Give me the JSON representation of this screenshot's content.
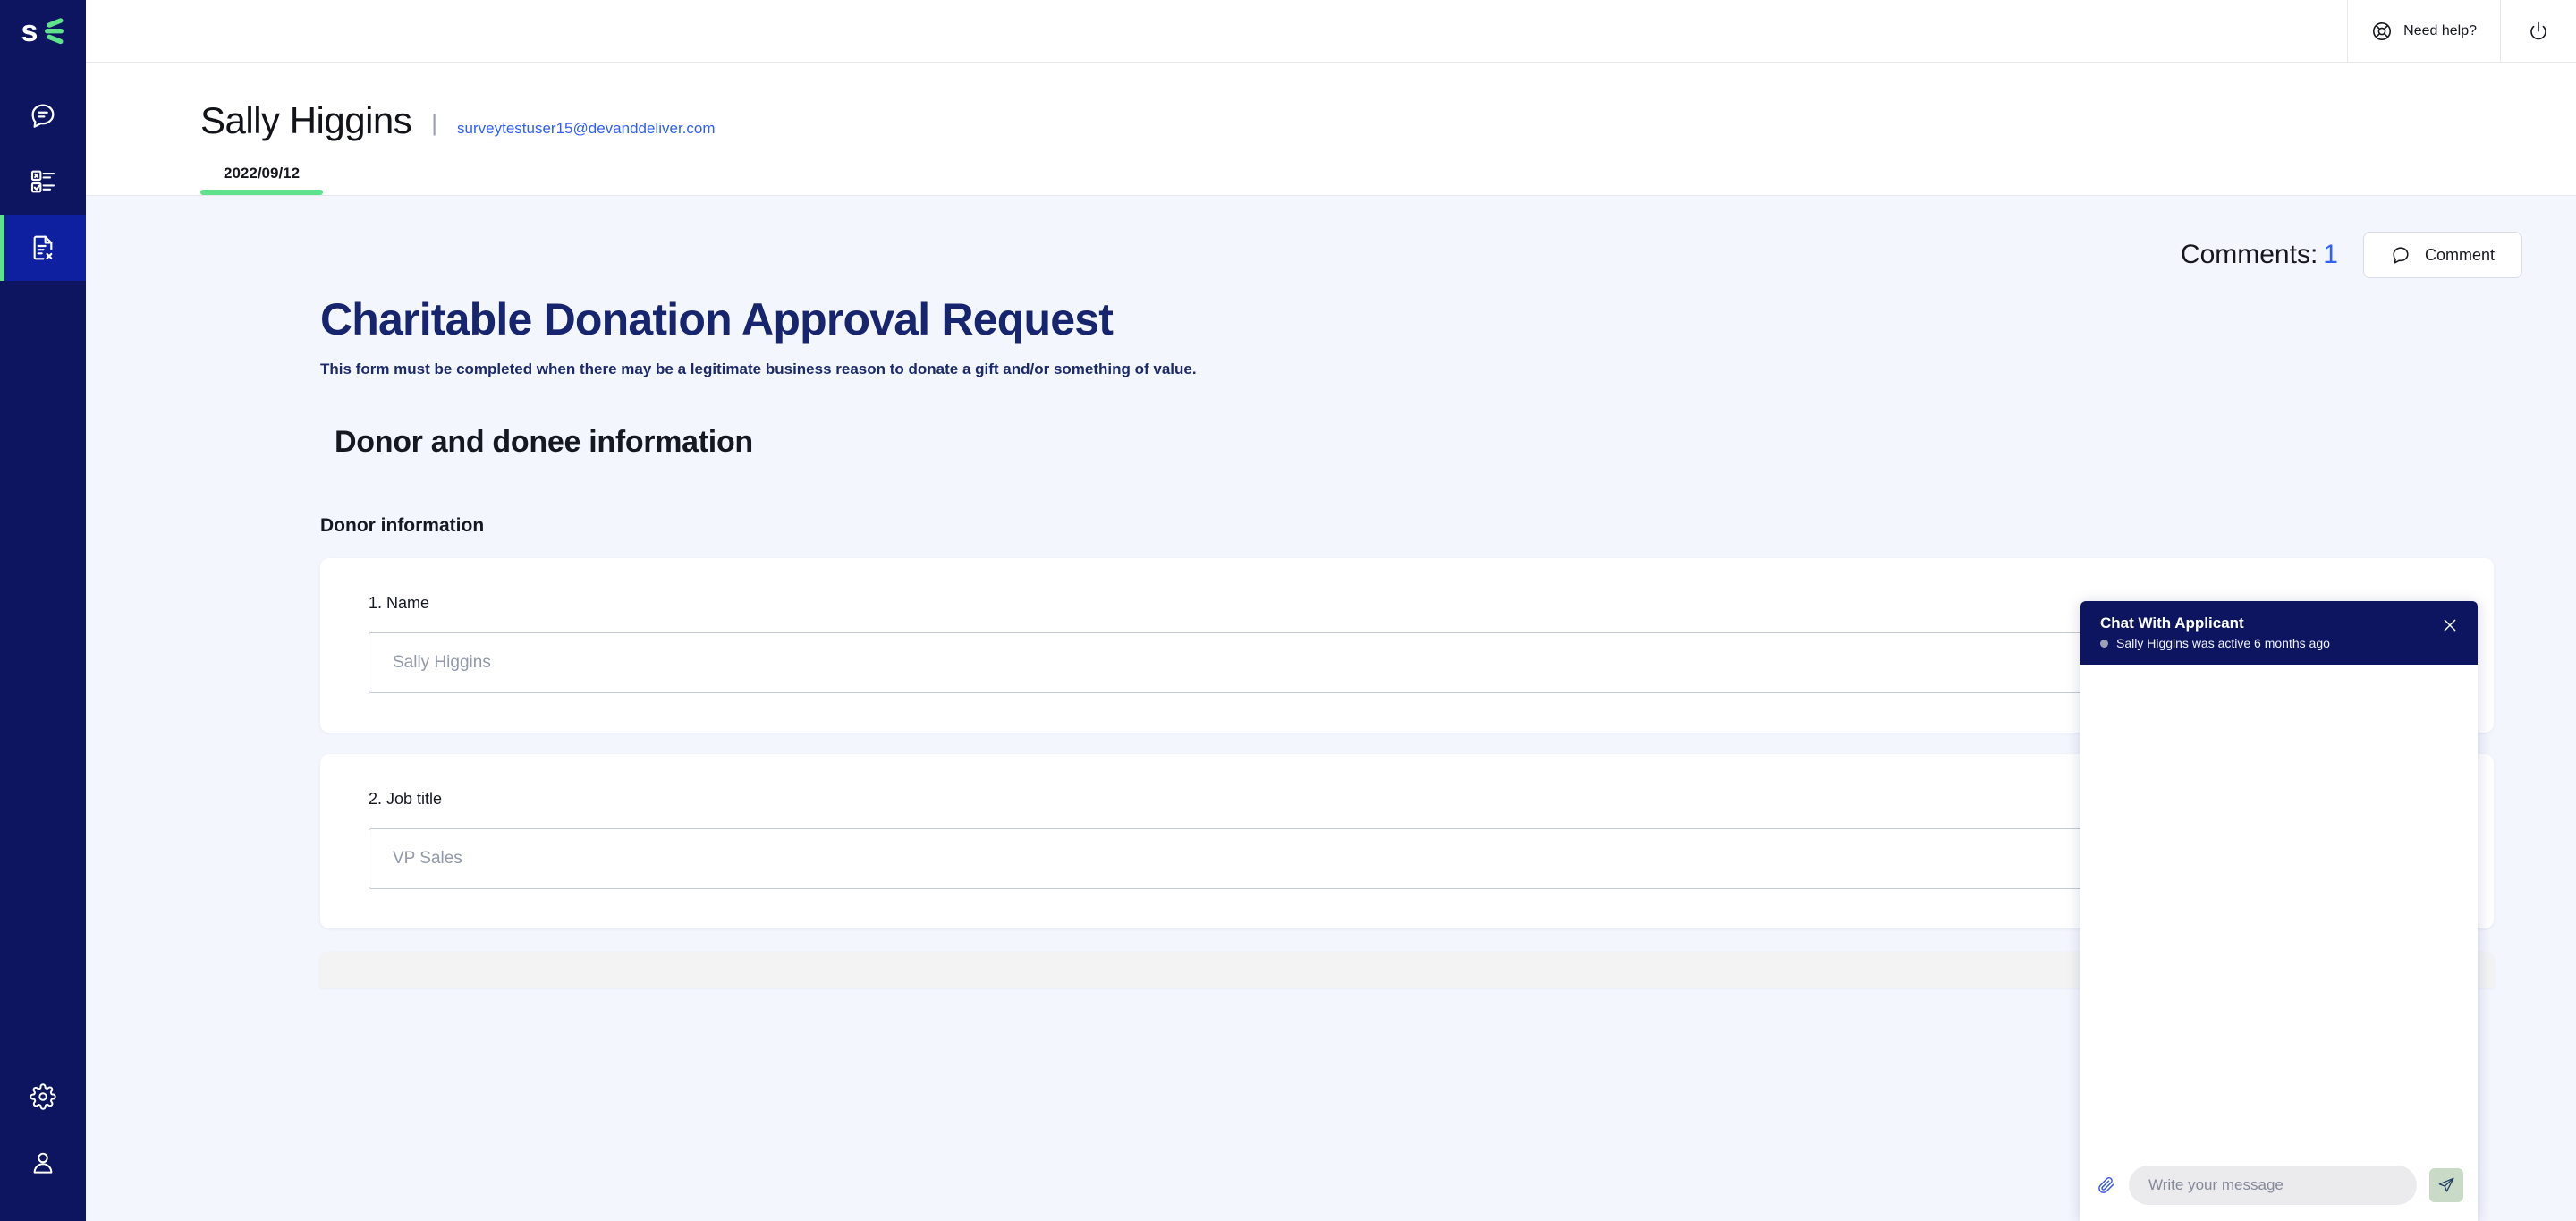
{
  "brand": {
    "logo_letter": "s",
    "navy": "#0d1560",
    "active_blue": "#0e20a0",
    "green": "#5ee28a",
    "link_blue": "#3160f6",
    "page_bg": "#f4f6fd"
  },
  "sidebar": {
    "items": [
      {
        "name": "chat-bubble-icon",
        "label": "Messages"
      },
      {
        "name": "survey-list-icon",
        "label": "Surveys"
      },
      {
        "name": "document-x-icon",
        "label": "Forms",
        "active": true
      }
    ],
    "bottom_items": [
      {
        "name": "gear-icon",
        "label": "Settings"
      },
      {
        "name": "user-icon",
        "label": "Account"
      }
    ]
  },
  "topbar": {
    "help_label": "Need help?",
    "help_icon": "lifebuoy-icon",
    "power_icon": "power-icon"
  },
  "header": {
    "person_name": "Sally Higgins",
    "separator": "|",
    "email": "surveytestuser15@devanddeliver.com"
  },
  "tabs": [
    {
      "label": "2022/09/12",
      "active": true
    }
  ],
  "comments": {
    "label": "Comments:",
    "count": "1",
    "button_label": "Comment",
    "button_icon": "speech-bubble-icon"
  },
  "form": {
    "title": "Charitable Donation Approval Request",
    "subtitle": "This form must be completed when there may be a legitimate business reason to donate a gift and/or something of value.",
    "section_heading": "Donor and donee information",
    "subsection_heading": "Donor information",
    "questions": [
      {
        "label": "1. Name",
        "value": "Sally Higgins",
        "placeholder": "Sally Higgins"
      },
      {
        "label": "2. Job title",
        "value": "VP Sales",
        "placeholder": "VP Sales"
      }
    ]
  },
  "chat": {
    "title": "Chat With Applicant",
    "status": "Sally Higgins was active 6 months ago",
    "close_icon": "close-icon",
    "attach_icon": "paperclip-icon",
    "send_icon": "send-icon",
    "input_placeholder": "Write your message",
    "input_value": ""
  }
}
